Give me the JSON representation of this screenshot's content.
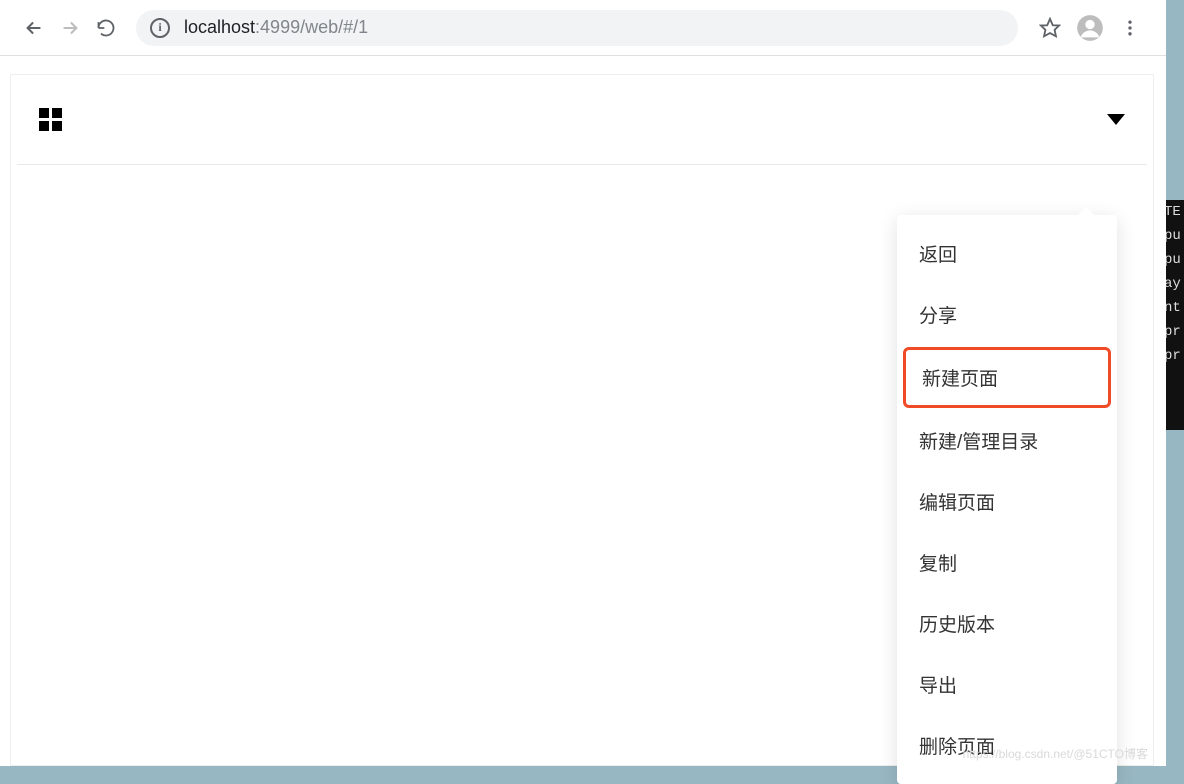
{
  "browser": {
    "url_host": "localhost",
    "url_path": ":4999/web/#/1",
    "info_symbol": "i"
  },
  "menu": {
    "items": [
      {
        "label": "返回",
        "highlighted": false
      },
      {
        "label": "分享",
        "highlighted": false
      },
      {
        "label": "新建页面",
        "highlighted": true
      },
      {
        "label": "新建/管理目录",
        "highlighted": false
      },
      {
        "label": "编辑页面",
        "highlighted": false
      },
      {
        "label": "复制",
        "highlighted": false
      },
      {
        "label": "历史版本",
        "highlighted": false
      },
      {
        "label": "导出",
        "highlighted": false
      },
      {
        "label": "删除页面",
        "highlighted": false
      }
    ]
  },
  "terminal_fragments": [
    "TE",
    "pu",
    "pu",
    "ay",
    "nt",
    "pr",
    "pr"
  ],
  "watermark": "https://blog.csdn.net/@51CTO博客"
}
